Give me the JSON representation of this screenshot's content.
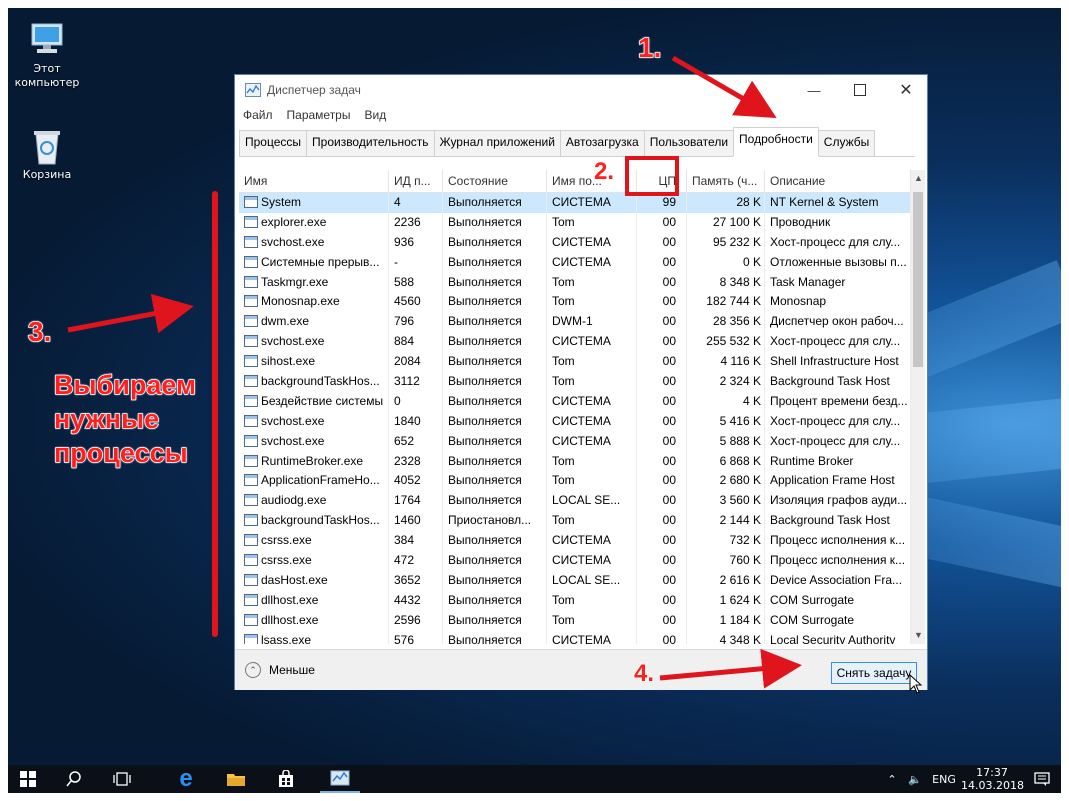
{
  "desktop": {
    "icons": [
      {
        "name": "this-pc",
        "label": "Этот компьютер"
      },
      {
        "name": "recycle-bin",
        "label": "Корзина"
      }
    ]
  },
  "window": {
    "title": "Диспетчер задач",
    "menu": [
      "Файл",
      "Параметры",
      "Вид"
    ],
    "tabs": [
      "Процессы",
      "Производительность",
      "Журнал приложений",
      "Автозагрузка",
      "Пользователи",
      "Подробности",
      "Службы"
    ],
    "active_tab": "Подробности",
    "columns": [
      "Имя",
      "ИД п...",
      "Состояние",
      "Имя по...",
      "ЦП",
      "Память (ч...",
      "Описание"
    ],
    "rows": [
      [
        "System",
        "4",
        "Выполняется",
        "СИСТЕМА",
        "99",
        "28 K",
        "NT Kernel & System"
      ],
      [
        "explorer.exe",
        "2236",
        "Выполняется",
        "Tom",
        "00",
        "27 100 K",
        "Проводник"
      ],
      [
        "svchost.exe",
        "936",
        "Выполняется",
        "СИСТЕМА",
        "00",
        "95 232 K",
        "Хост-процесс для слу..."
      ],
      [
        "Системные прерыв...",
        "-",
        "Выполняется",
        "СИСТЕМА",
        "00",
        "0 K",
        "Отложенные вызовы п..."
      ],
      [
        "Taskmgr.exe",
        "588",
        "Выполняется",
        "Tom",
        "00",
        "8 348 K",
        "Task Manager"
      ],
      [
        "Monosnap.exe",
        "4560",
        "Выполняется",
        "Tom",
        "00",
        "182 744 K",
        "Monosnap"
      ],
      [
        "dwm.exe",
        "796",
        "Выполняется",
        "DWM-1",
        "00",
        "28 356 K",
        "Диспетчер окон рабоч..."
      ],
      [
        "svchost.exe",
        "884",
        "Выполняется",
        "СИСТЕМА",
        "00",
        "255 532 K",
        "Хост-процесс для слу..."
      ],
      [
        "sihost.exe",
        "2084",
        "Выполняется",
        "Tom",
        "00",
        "4 116 K",
        "Shell Infrastructure Host"
      ],
      [
        "backgroundTaskHos...",
        "3112",
        "Выполняется",
        "Tom",
        "00",
        "2 324 K",
        "Background Task Host"
      ],
      [
        "Бездействие системы",
        "0",
        "Выполняется",
        "СИСТЕМА",
        "00",
        "4 K",
        "Процент времени безд..."
      ],
      [
        "svchost.exe",
        "1840",
        "Выполняется",
        "СИСТЕМА",
        "00",
        "5 416 K",
        "Хост-процесс для слу..."
      ],
      [
        "svchost.exe",
        "652",
        "Выполняется",
        "СИСТЕМА",
        "00",
        "5 888 K",
        "Хост-процесс для слу..."
      ],
      [
        "RuntimeBroker.exe",
        "2328",
        "Выполняется",
        "Tom",
        "00",
        "6 868 K",
        "Runtime Broker"
      ],
      [
        "ApplicationFrameHo...",
        "4052",
        "Выполняется",
        "Tom",
        "00",
        "2 680 K",
        "Application Frame Host"
      ],
      [
        "audiodg.exe",
        "1764",
        "Выполняется",
        "LOCAL SE...",
        "00",
        "3 560 K",
        "Изоляция графов ауди..."
      ],
      [
        "backgroundTaskHos...",
        "1460",
        "Приостановл...",
        "Tom",
        "00",
        "2 144 K",
        "Background Task Host"
      ],
      [
        "csrss.exe",
        "384",
        "Выполняется",
        "СИСТЕМА",
        "00",
        "732 K",
        "Процесс исполнения к..."
      ],
      [
        "csrss.exe",
        "472",
        "Выполняется",
        "СИСТЕМА",
        "00",
        "760 K",
        "Процесс исполнения к..."
      ],
      [
        "dasHost.exe",
        "3652",
        "Выполняется",
        "LOCAL SE...",
        "00",
        "2 616 K",
        "Device Association Fra..."
      ],
      [
        "dllhost.exe",
        "4432",
        "Выполняется",
        "Tom",
        "00",
        "1 624 K",
        "COM Surrogate"
      ],
      [
        "dllhost.exe",
        "2596",
        "Выполняется",
        "Tom",
        "00",
        "1 184 K",
        "COM Surrogate"
      ],
      [
        "lsass.exe",
        "576",
        "Выполняется",
        "СИСТЕМА",
        "00",
        "4 348 K",
        "Local Security Authority"
      ]
    ],
    "footer": {
      "less_label": "Меньше",
      "end_task_label": "Снять задачу"
    }
  },
  "annotations": {
    "step1": "1.",
    "step2": "2.",
    "step3": "3.",
    "step4": "4.",
    "caption": [
      "Выбираем",
      "нужные",
      "процессы"
    ],
    "color": "#ff1f1f"
  },
  "taskbar": {
    "language": "ENG",
    "time": "17:37",
    "date": "14.03.2018"
  }
}
